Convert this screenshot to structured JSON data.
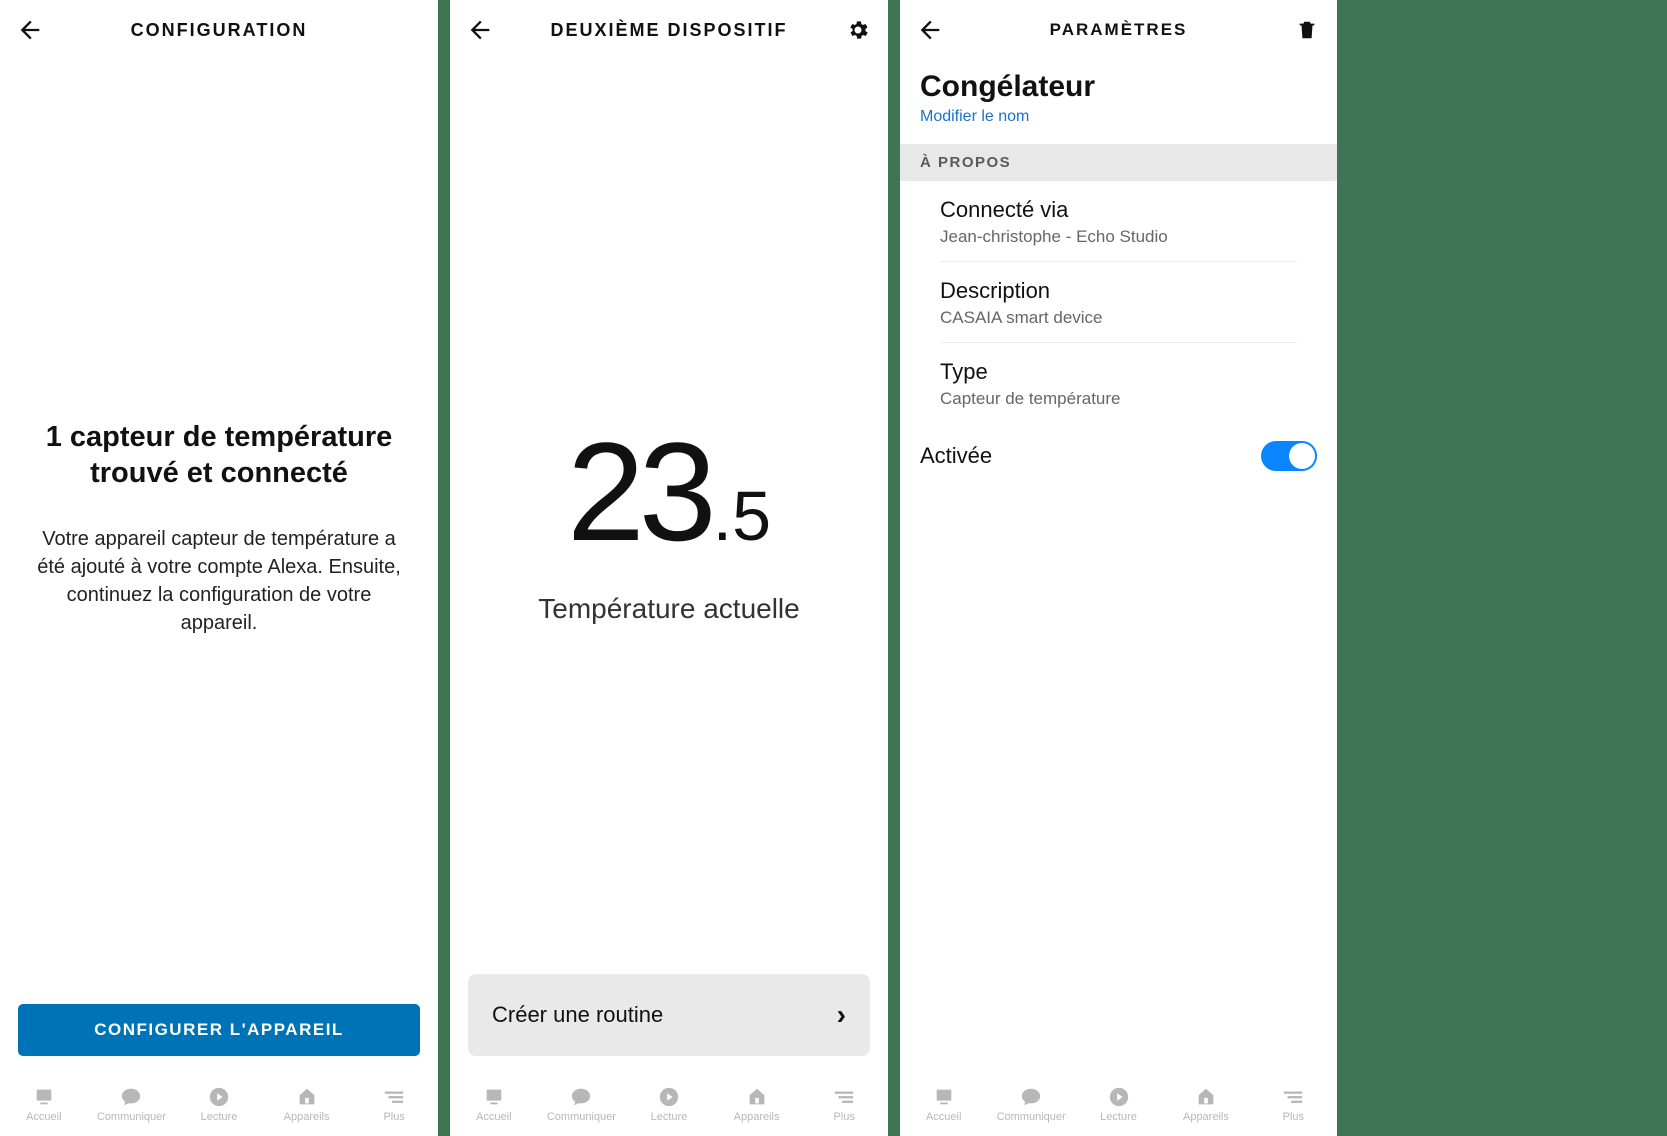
{
  "screen1": {
    "header_title": "CONFIGURATION",
    "heading": "1 capteur de température trouvé et connecté",
    "description": "Votre appareil capteur de température a été ajouté à votre compte Alexa. Ensuite, continuez la configuration de votre appareil.",
    "cta_label": "CONFIGURER L'APPAREIL"
  },
  "screen2": {
    "header_title": "DEUXIÈME DISPOSITIF",
    "temp_integer": "23",
    "temp_decimal": ".5",
    "temp_label": "Température actuelle",
    "routine_label": "Créer une routine"
  },
  "screen3": {
    "header_title": "PARAMÈTRES",
    "device_name": "Congélateur",
    "edit_name_label": "Modifier le nom",
    "section_about": "À PROPOS",
    "rows": {
      "connected_via": {
        "label": "Connecté via",
        "value": "Jean-christophe - Echo Studio"
      },
      "description": {
        "label": "Description",
        "value": "CASAIA smart device"
      },
      "type": {
        "label": "Type",
        "value": "Capteur de température"
      },
      "enabled": {
        "label": "Activée",
        "value": true
      }
    }
  },
  "nav": {
    "home": "Accueil",
    "communicate": "Communiquer",
    "play": "Lecture",
    "devices": "Appareils",
    "more": "Plus"
  }
}
